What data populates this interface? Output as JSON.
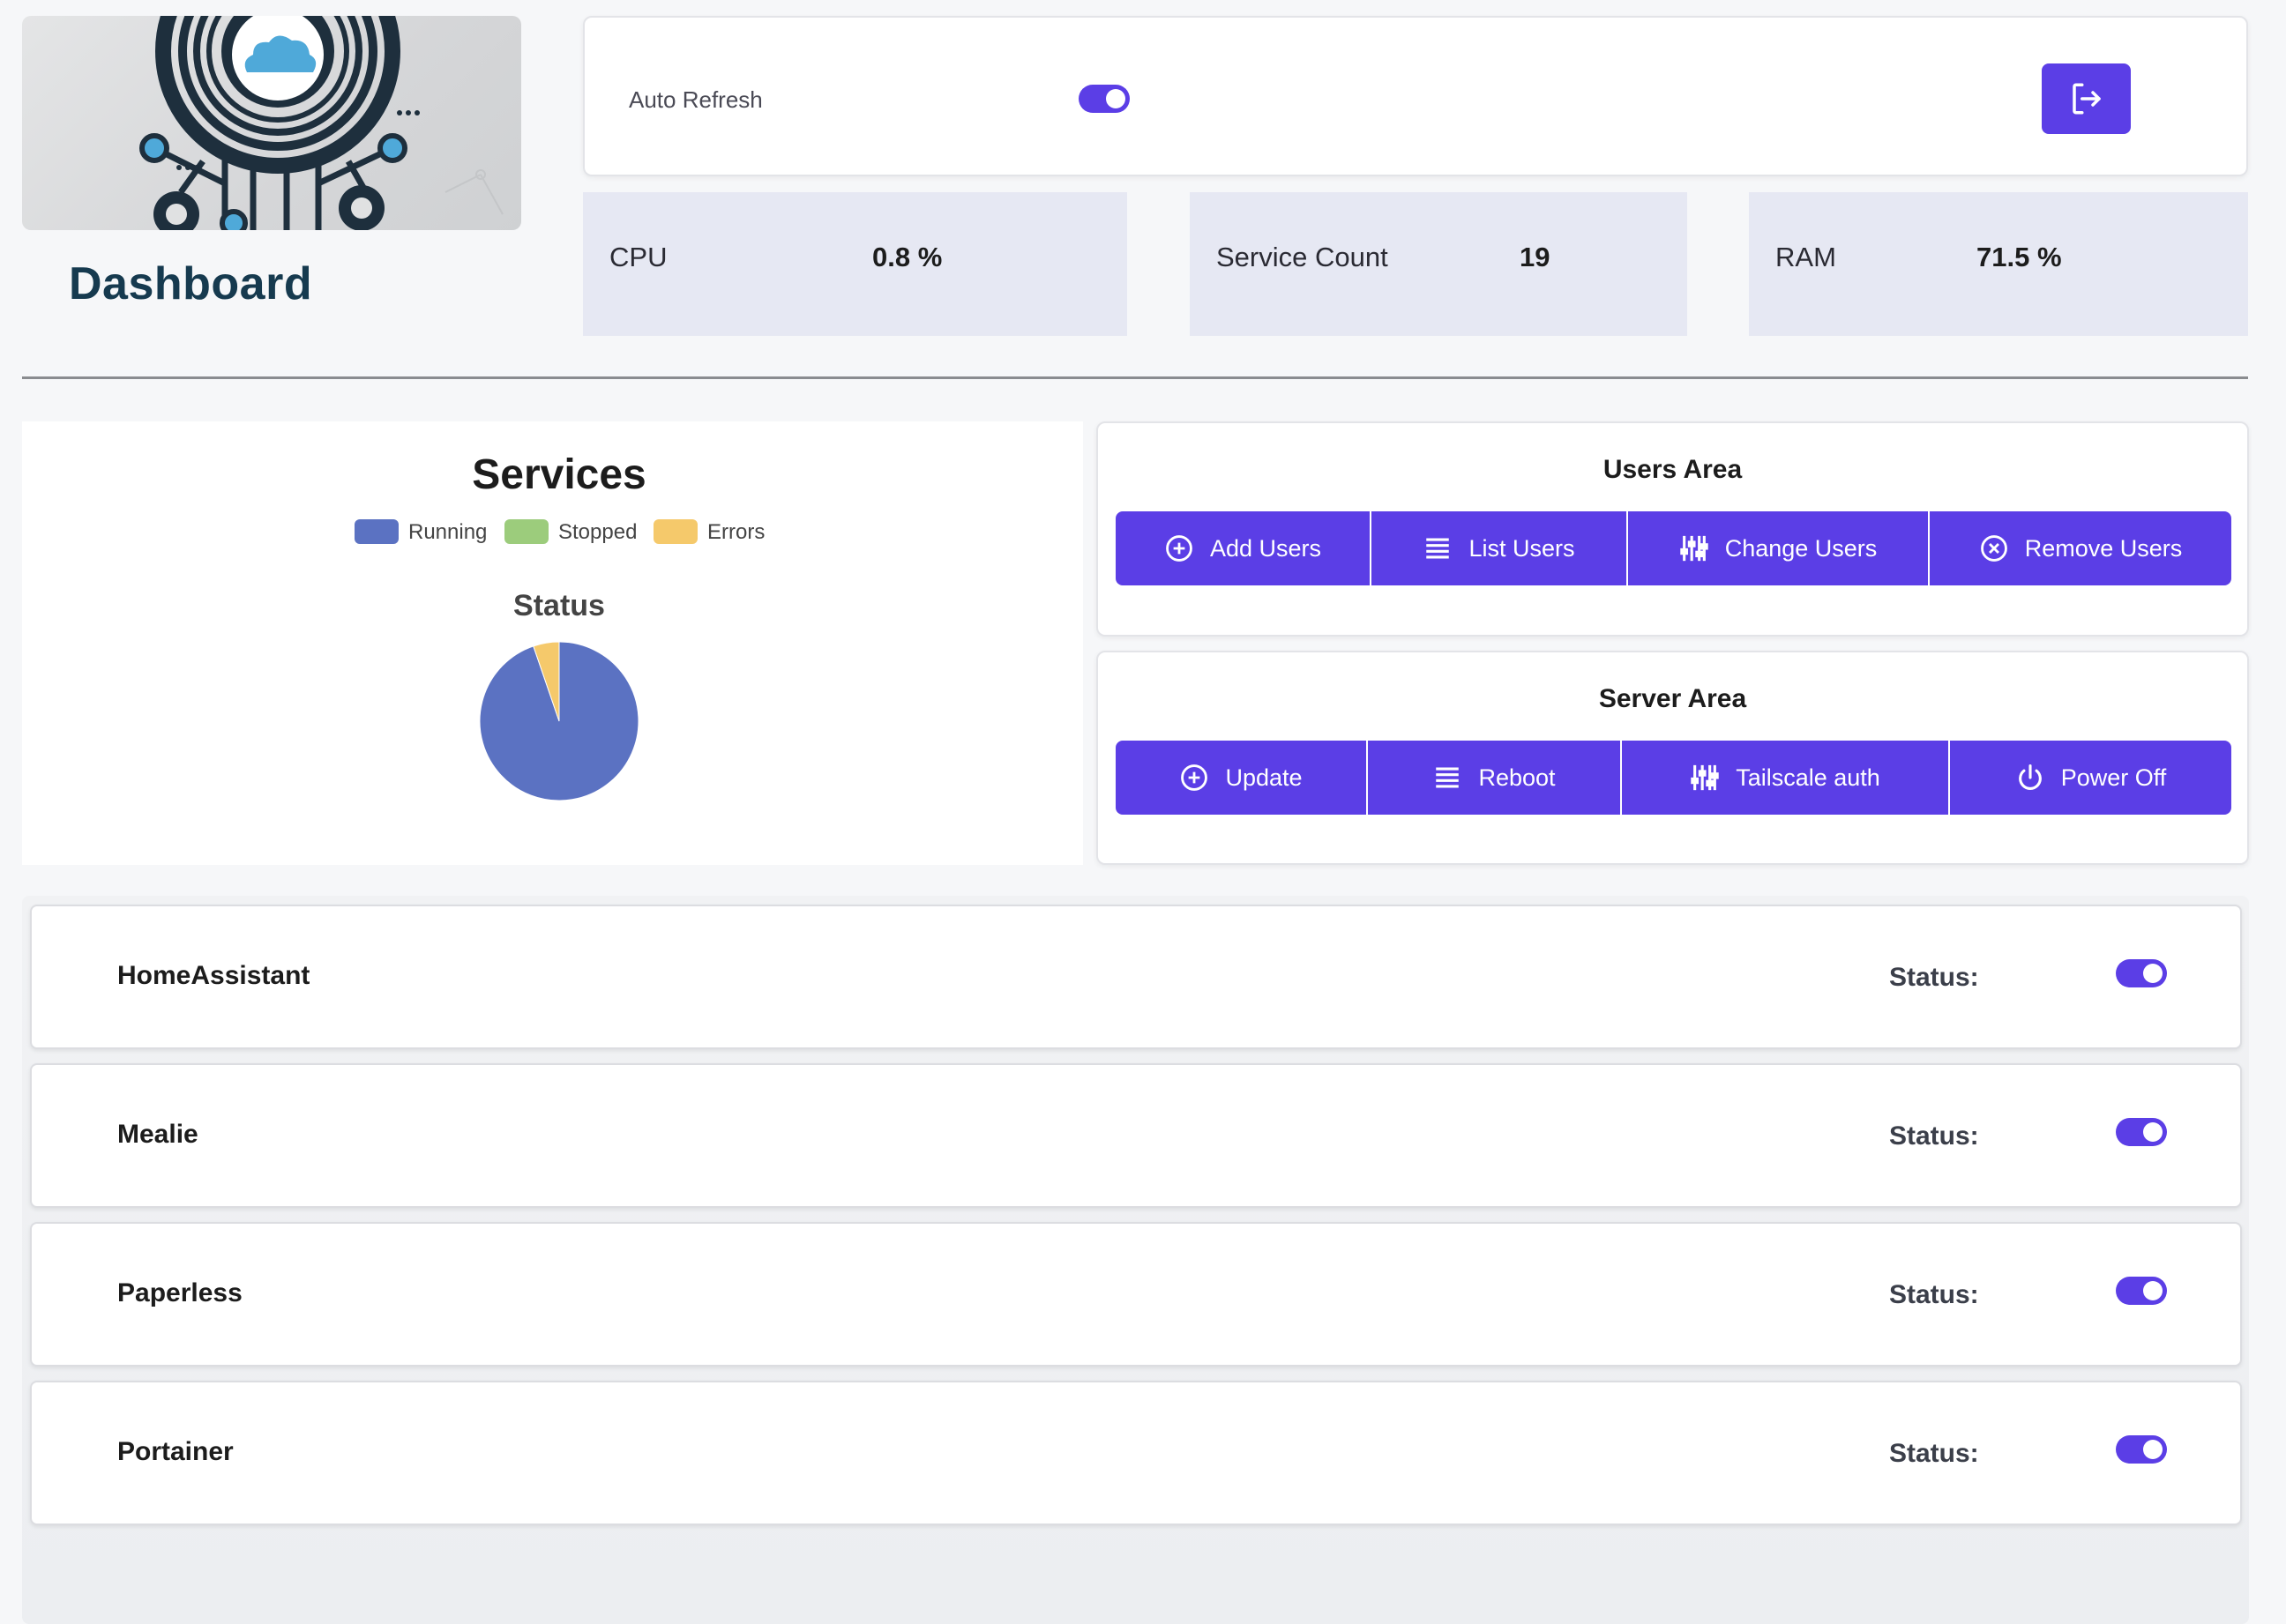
{
  "header": {
    "title": "Dashboard",
    "logo": "network-cloud-logo",
    "auto_refresh_label": "Auto Refresh",
    "auto_refresh_on": true,
    "logout_icon": "logout-icon"
  },
  "stats": {
    "cpu": {
      "label": "CPU",
      "value": "0.8 %"
    },
    "service_count": {
      "label": "Service Count",
      "value": "19"
    },
    "ram": {
      "label": "RAM",
      "value": "71.5 %"
    }
  },
  "chart_data": {
    "type": "pie",
    "heading": "Services",
    "title": "Status",
    "categories": [
      "Running",
      "Stopped",
      "Errors"
    ],
    "values": [
      18,
      0,
      1
    ],
    "colors": [
      "#5b72c2",
      "#9ccc7c",
      "#f5c96b"
    ],
    "legend": "top"
  },
  "users_area": {
    "title": "Users Area",
    "buttons": [
      {
        "label": "Add Users",
        "icon": "plus-circle-icon"
      },
      {
        "label": "List Users",
        "icon": "list-icon"
      },
      {
        "label": "Change Users",
        "icon": "sliders-icon"
      },
      {
        "label": "Remove Users",
        "icon": "x-circle-icon"
      }
    ]
  },
  "server_area": {
    "title": "Server Area",
    "buttons": [
      {
        "label": "Update",
        "icon": "plus-circle-icon"
      },
      {
        "label": "Reboot",
        "icon": "list-icon"
      },
      {
        "label": "Tailscale auth",
        "icon": "sliders-icon"
      },
      {
        "label": "Power Off",
        "icon": "power-icon"
      }
    ]
  },
  "services": [
    {
      "name": "HomeAssistant",
      "status_label": "Status:",
      "enabled": true
    },
    {
      "name": "Mealie",
      "status_label": "Status:",
      "enabled": true
    },
    {
      "name": "Paperless",
      "status_label": "Status:",
      "enabled": true
    },
    {
      "name": "Portainer",
      "status_label": "Status:",
      "enabled": true
    }
  ],
  "colors": {
    "accent": "#5b3ee6",
    "stat_bg": "#e6e8f3",
    "title": "#163a4f"
  }
}
